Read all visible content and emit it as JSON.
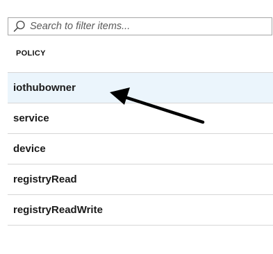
{
  "search": {
    "placeholder": "Search to filter items...",
    "icon": "search-icon"
  },
  "table": {
    "column_header": "POLICY",
    "rows": [
      {
        "label": "iothubowner",
        "selected": true
      },
      {
        "label": "service",
        "selected": false
      },
      {
        "label": "device",
        "selected": false
      },
      {
        "label": "registryRead",
        "selected": false
      },
      {
        "label": "registryReadWrite",
        "selected": false
      }
    ]
  },
  "colors": {
    "selected_row_background": "#ebf5fc",
    "divider": "#d6d6d6",
    "annotation_arrow": "#000000"
  }
}
